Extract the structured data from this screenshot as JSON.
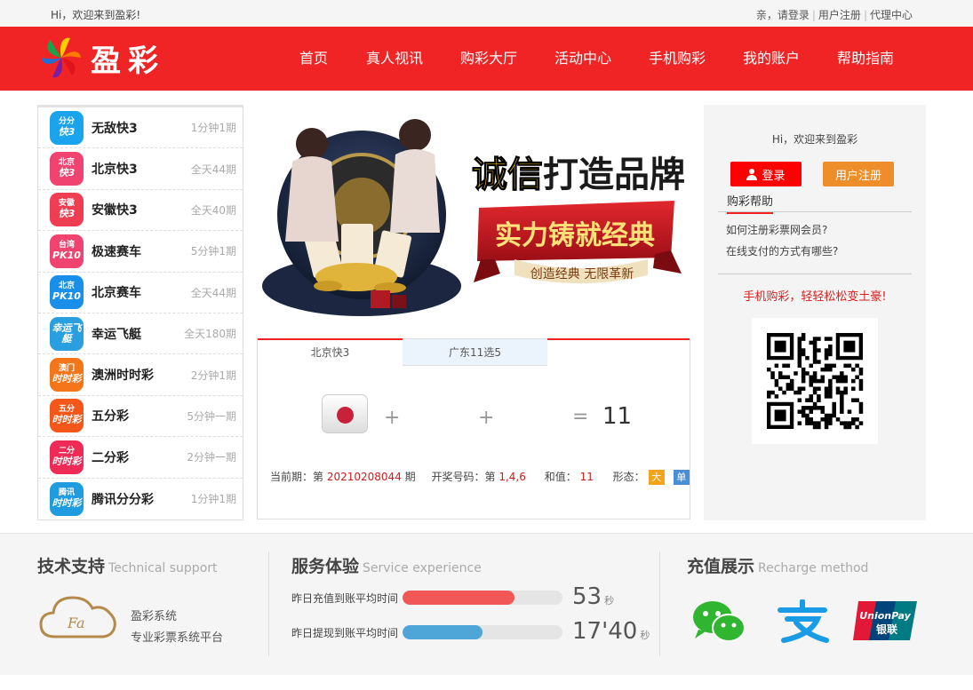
{
  "topbar": {
    "welcome": "Hi，欢迎来到盈彩!",
    "greet": "亲，请登录",
    "register": "用户注册",
    "agent": "代理中心"
  },
  "header": {
    "logo_text": "盈彩",
    "nav": [
      "首页",
      "真人视讯",
      "购彩大厅",
      "活动中心",
      "手机购彩",
      "我的账户",
      "帮助指南"
    ]
  },
  "games": [
    {
      "name": "无敌快3",
      "period": "1分钟1期",
      "icon_top": "分分",
      "icon_main": "快3",
      "color": "#1aa4ee"
    },
    {
      "name": "北京快3",
      "period": "全天44期",
      "icon_top": "北京",
      "icon_main": "快3",
      "color": "#f0436f"
    },
    {
      "name": "安徽快3",
      "period": "全天40期",
      "icon_top": "安徽",
      "icon_main": "快3",
      "color": "#ef3d52"
    },
    {
      "name": "极速赛车",
      "period": "5分钟1期",
      "icon_top": "台湾",
      "icon_main": "PK10",
      "color": "#f0436f"
    },
    {
      "name": "北京赛车",
      "period": "全天44期",
      "icon_top": "北京",
      "icon_main": "PK10",
      "color": "#1a8fea"
    },
    {
      "name": "幸运飞艇",
      "period": "全天180期",
      "icon_top": "",
      "icon_main": "幸运飞艇",
      "color": "#2a9fe0"
    },
    {
      "name": "澳洲时时彩",
      "period": "2分钟1期",
      "icon_top": "澳门",
      "icon_main": "时时彩",
      "color": "#f5761a"
    },
    {
      "name": "五分彩",
      "period": "5分钟一期",
      "icon_top": "五分",
      "icon_main": "时时彩",
      "color": "#f5561a"
    },
    {
      "name": "二分彩",
      "period": "2分钟一期",
      "icon_top": "二分",
      "icon_main": "时时彩",
      "color": "#ee2a56"
    },
    {
      "name": "腾讯分分彩",
      "period": "1分钟1期",
      "icon_top": "腾讯",
      "icon_main": "时时彩",
      "color": "#1f9be0"
    }
  ],
  "banner": {
    "line1": "诚信打造品牌",
    "line2": "实力铸就经典",
    "line3": "创造经典 无限革新"
  },
  "lottery": {
    "tabs": [
      "北京快3",
      "广东11选5"
    ],
    "plus": "+",
    "equals": "=",
    "sum": "11",
    "period_label": "当前期：第",
    "period": "20210208044",
    "period_suffix": "期",
    "draw_label": "开奖号码：第",
    "draw_numbers": "1,4,6",
    "sum_label": "和值：",
    "sum_value": "11",
    "shape_label": "形态：",
    "shape_big": "大",
    "shape_odd": "单"
  },
  "right_panel": {
    "welcome": "Hi，欢迎来到盈彩",
    "login": "登录",
    "register": "用户注册",
    "help_title": "购彩帮助",
    "help_q1": "如何注册彩票网会员?",
    "help_q2": "在线支付的方式有哪些?",
    "mobile_slogan": "手机购彩，轻轻松松变土豪!"
  },
  "footer": {
    "tech_title": "技术支持",
    "tech_en": "Technical support",
    "tech_line1": "盈彩系统",
    "tech_line2": "专业彩票系统平台",
    "service_title": "服务体验",
    "service_en": "Service experience",
    "deposit_label": "昨日充值到账平均时间",
    "deposit_value": "53",
    "deposit_unit": "秒",
    "deposit_fill": 0.7,
    "withdraw_label": "昨日提现到账平均时间",
    "withdraw_value": "17'40",
    "withdraw_unit": "秒",
    "withdraw_fill": 0.5,
    "recharge_title": "充值展示",
    "recharge_en": "Recharge method",
    "unionpay_en": "UnionPay",
    "unionpay_cn": "银联"
  },
  "colors": {
    "brand_red": "#f02424",
    "deposit_bar": "#f25757",
    "withdraw_bar": "#4ea6d8"
  }
}
